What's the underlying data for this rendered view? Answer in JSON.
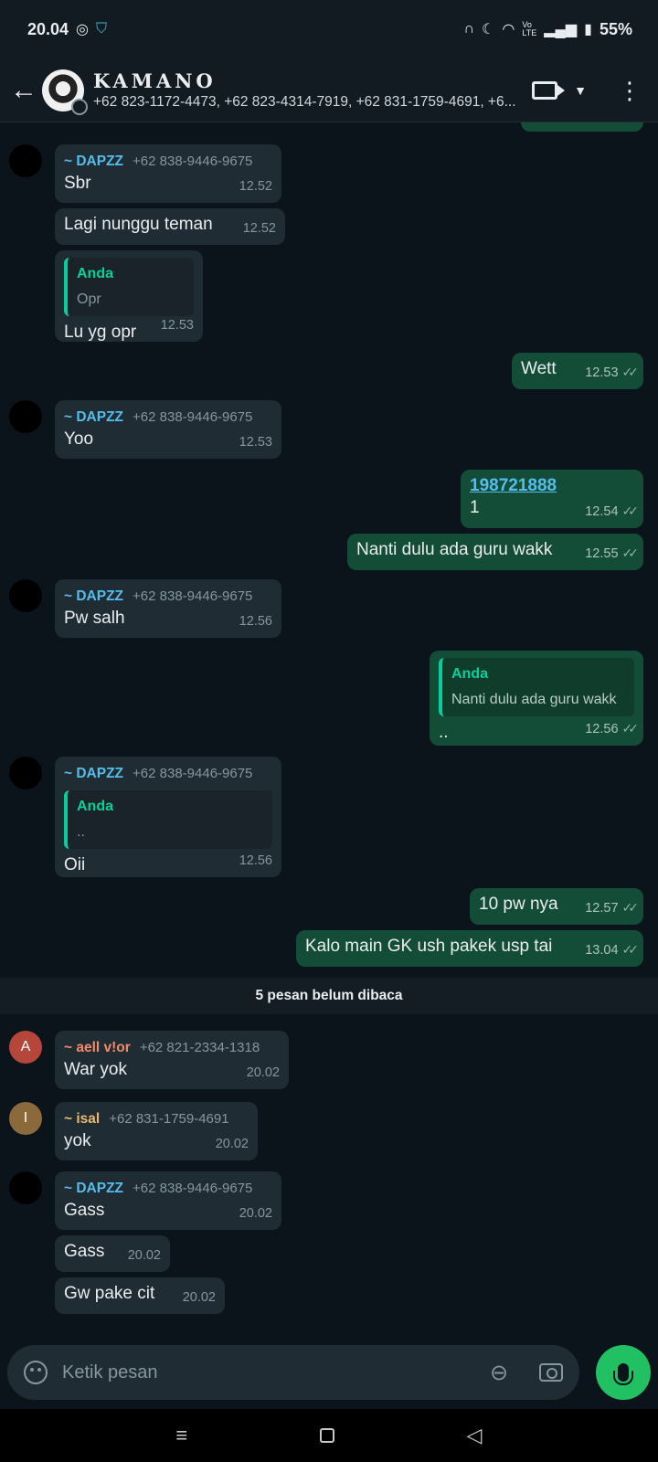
{
  "status_bar": {
    "time": "20.04",
    "network_label": "Vo\nLTE",
    "battery": "55%"
  },
  "header": {
    "group_name": "KAMANO",
    "members": "+62 823-1172-4473, +62 823-4314-7919, +62 831-1759-4691, +6..."
  },
  "messages": [
    {
      "sender": "~ DAPZZ",
      "phone": "+62 838-9446-9675",
      "text": "Sbr",
      "time": "12.52"
    },
    {
      "text": "Lagi nunggu teman",
      "time": "12.52"
    },
    {
      "quote_name": "Anda",
      "quote_text": "Opr",
      "text": "Lu yg opr",
      "time": "12.53"
    },
    {
      "text": "Wett",
      "time": "12.53"
    },
    {
      "sender": "~ DAPZZ",
      "phone": "+62 838-9446-9675",
      "text": "Yoo",
      "time": "12.53"
    },
    {
      "link": "198721888",
      "text": "1",
      "time": "12.54"
    },
    {
      "text": "Nanti dulu ada guru wakk",
      "time": "12.55"
    },
    {
      "sender": "~ DAPZZ",
      "phone": "+62 838-9446-9675",
      "text": "Pw salh",
      "time": "12.56"
    },
    {
      "quote_name": "Anda",
      "quote_text": "Nanti dulu ada guru wakk",
      "text": "..",
      "time": "12.56"
    },
    {
      "sender": "~ DAPZZ",
      "phone": "+62 838-9446-9675",
      "quote_name": "Anda",
      "quote_text": "..",
      "text": "Oii",
      "time": "12.56"
    },
    {
      "text": "10 pw nya",
      "time": "12.57"
    },
    {
      "text": "Kalo main GK ush pakek usp tai",
      "time": "13.04"
    },
    {
      "sender": "~ aell v!or",
      "phone": "+62 821-2334-1318",
      "avatar_letter": "A",
      "text": "War yok",
      "time": "20.02"
    },
    {
      "sender": "~ isal",
      "phone": "+62 831-1759-4691",
      "avatar_letter": "I",
      "text": "yok",
      "time": "20.02"
    },
    {
      "sender": "~ DAPZZ",
      "phone": "+62 838-9446-9675",
      "text": "Gass",
      "time": "20.02"
    },
    {
      "text": "Gass",
      "time": "20.02"
    },
    {
      "text": "Gw pake cit",
      "time": "20.02"
    }
  ],
  "unread_divider": "5 pesan belum dibaca",
  "composer": {
    "placeholder": "Ketik pesan"
  },
  "colors": {
    "accent_green": "#21c063",
    "quote_teal": "#06cf9c",
    "sender_dapzz": "#53bdeb",
    "sender_aell": "#f28a6b",
    "sender_isal": "#e9b96e",
    "outgoing_bubble": "#144d37",
    "incoming_bubble": "#202c33"
  }
}
